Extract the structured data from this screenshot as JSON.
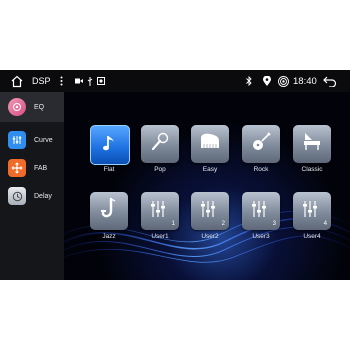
{
  "status_bar": {
    "title": "DSP",
    "time": "18:40",
    "icons": [
      "home-icon",
      "more-vert-icon",
      "video-icon",
      "usb-icon",
      "image-icon",
      "bluetooth-icon",
      "location-icon",
      "wifi-hotspot-icon",
      "back-icon"
    ]
  },
  "sidebar": {
    "items": [
      {
        "label": "EQ",
        "icon": "eq-icon",
        "color": "#e46a93",
        "active": true
      },
      {
        "label": "Curve",
        "icon": "curve-icon",
        "color": "#2f8ef0",
        "active": false
      },
      {
        "label": "FAB",
        "icon": "fab-icon",
        "color": "#f06b2a",
        "active": false
      },
      {
        "label": "Delay",
        "icon": "delay-icon",
        "color": "#c8ccd4",
        "active": false
      }
    ]
  },
  "presets": [
    {
      "label": "Flat",
      "icon": "music-note-icon",
      "selected": true
    },
    {
      "label": "Pop",
      "icon": "microphone-icon",
      "selected": false
    },
    {
      "label": "Easy",
      "icon": "piano-icon",
      "selected": false
    },
    {
      "label": "Rock",
      "icon": "guitar-icon",
      "selected": false
    },
    {
      "label": "Classic",
      "icon": "grand-piano-icon",
      "selected": false
    },
    {
      "label": "Jazz",
      "icon": "saxophone-icon",
      "selected": false
    },
    {
      "label": "User1",
      "icon": "sliders-icon",
      "number": "1",
      "selected": false
    },
    {
      "label": "User2",
      "icon": "sliders-icon",
      "number": "2",
      "selected": false
    },
    {
      "label": "User3",
      "icon": "sliders-icon",
      "number": "3",
      "selected": false
    },
    {
      "label": "User4",
      "icon": "sliders-icon",
      "number": "4",
      "selected": false
    }
  ],
  "colors": {
    "accent": "#1c6fe0",
    "tile": "#8a95a5",
    "sidebar_bg": "#15161a"
  }
}
